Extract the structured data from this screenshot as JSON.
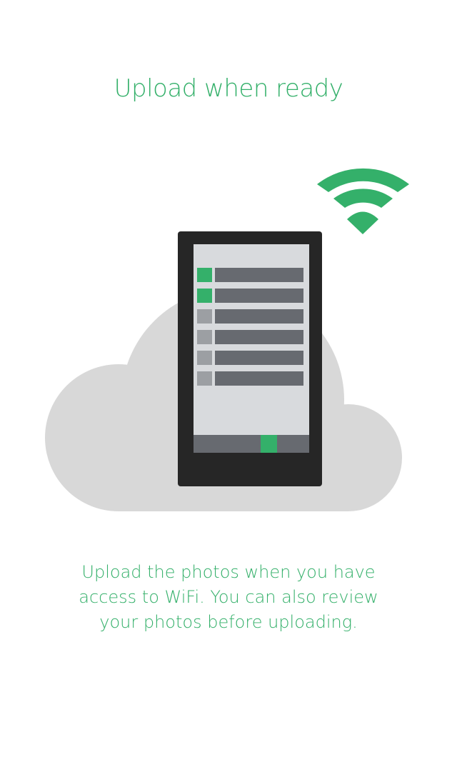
{
  "onboarding": {
    "title": "Upload when ready",
    "description": "Upload the photos when you have access to WiFi. You can also review your photos before uploading."
  },
  "illustration": {
    "cloud_icon": "cloud-icon",
    "wifi_icon": "wifi-icon",
    "phone_icon": "phone-icon",
    "photo_list_rows": [
      {
        "selected": true
      },
      {
        "selected": true
      },
      {
        "selected": false
      },
      {
        "selected": false
      },
      {
        "selected": false
      },
      {
        "selected": false
      }
    ]
  },
  "colors": {
    "accent": "#34b06a",
    "cloud": "#d8d8d8",
    "phone_body": "#262626",
    "screen": "#d8dadd",
    "row_bar": "#676a70",
    "row_unselected": "#9c9fa3",
    "nav_bar": "#676a70"
  }
}
